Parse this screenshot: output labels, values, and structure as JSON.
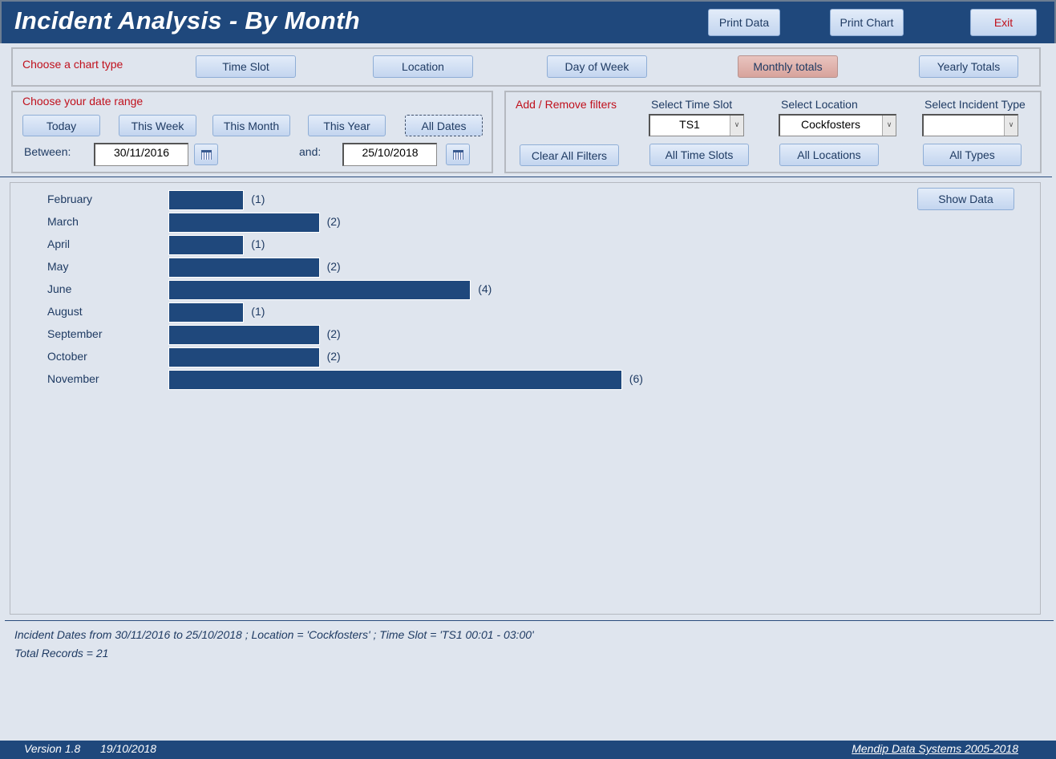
{
  "header": {
    "title": "Incident Analysis - By Month",
    "print_data": "Print Data",
    "print_chart": "Print Chart",
    "exit": "Exit"
  },
  "chart_type": {
    "label": "Choose a chart type",
    "buttons": [
      "Time Slot",
      "Location",
      "Day of Week",
      "Monthly totals",
      "Yearly Totals"
    ],
    "active": "Monthly totals"
  },
  "date_range": {
    "label": "Choose your date range",
    "buttons": [
      "Today",
      "This Week",
      "This Month",
      "This Year",
      "All Dates"
    ],
    "between_label": "Between:",
    "start": "30/11/2016",
    "and_label": "and:",
    "end": "25/10/2018"
  },
  "filters": {
    "label": "Add / Remove filters",
    "time_slot_label": "Select Time Slot",
    "time_slot_value": "TS1",
    "location_label": "Select Location",
    "location_value": "Cockfosters",
    "incident_type_label": "Select Incident Type",
    "incident_type_value": "",
    "clear_all": "Clear All Filters",
    "all_time_slots": "All Time Slots",
    "all_locations": "All Locations",
    "all_types": "All Types"
  },
  "show_data": "Show Data",
  "chart_data": {
    "type": "bar",
    "orientation": "horizontal",
    "categories": [
      "February",
      "March",
      "April",
      "May",
      "June",
      "August",
      "September",
      "October",
      "November"
    ],
    "values": [
      1,
      2,
      1,
      2,
      4,
      1,
      2,
      2,
      6
    ],
    "value_labels": [
      "(1)",
      "(2)",
      "(1)",
      "(2)",
      "(4)",
      "(1)",
      "(2)",
      "(2)",
      "(6)"
    ],
    "bar_color": "#1f487c"
  },
  "summary": {
    "line1": "Incident Dates from 30/11/2016 to 25/10/2018 ; Location = 'Cockfosters' ; Time Slot = 'TS1  00:01 - 03:00'",
    "line2": "Total Records = 21"
  },
  "footer": {
    "version": "Version 1.8",
    "date": "19/10/2018",
    "company": "Mendip Data Systems 2005-2018"
  }
}
